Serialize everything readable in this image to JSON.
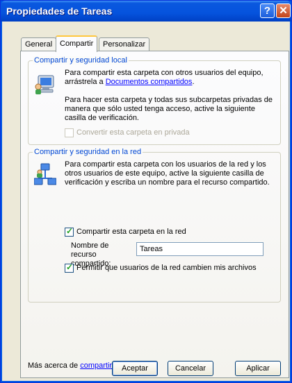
{
  "window": {
    "title": "Propiedades de Tareas",
    "help_glyph": "?",
    "close_glyph": "✕"
  },
  "tabs": [
    {
      "label": "General"
    },
    {
      "label": "Compartir",
      "active": true
    },
    {
      "label": "Personalizar"
    }
  ],
  "local_group": {
    "title": "Compartir y seguridad local",
    "para1_pre": "Para compartir esta carpeta con otros usuarios del equipo, arrástrela a ",
    "para1_link": "Documentos compartidos",
    "para1_post": ".",
    "para2": "Para hacer esta carpeta y todas sus subcarpetas privadas de manera que sólo usted tenga acceso, active la siguiente casilla de verificación.",
    "private_checkbox_label": "Convertir esta carpeta en privada",
    "private_checked": false
  },
  "network_group": {
    "title": "Compartir y seguridad en la red",
    "paragraph": "Para compartir esta carpeta con los usuarios de la red y los otros usuarios de este equipo, active la siguiente casilla de verificación y escriba un nombre para el recurso compartido.",
    "share_checkbox_label": "Compartir esta carpeta en la red",
    "share_checked": true,
    "share_name_label": "Nombre de recurso compartido:",
    "share_name_value": "Tareas",
    "allow_change_label": "Permitir que usuarios de la red cambien mis archivos",
    "allow_change_checked": true
  },
  "footer": {
    "more_pre": "Más acerca de ",
    "more_link": "compartir y seguridad",
    "more_post": "."
  },
  "buttons": {
    "ok": "Aceptar",
    "cancel": "Cancelar",
    "apply": "Aplicar"
  }
}
